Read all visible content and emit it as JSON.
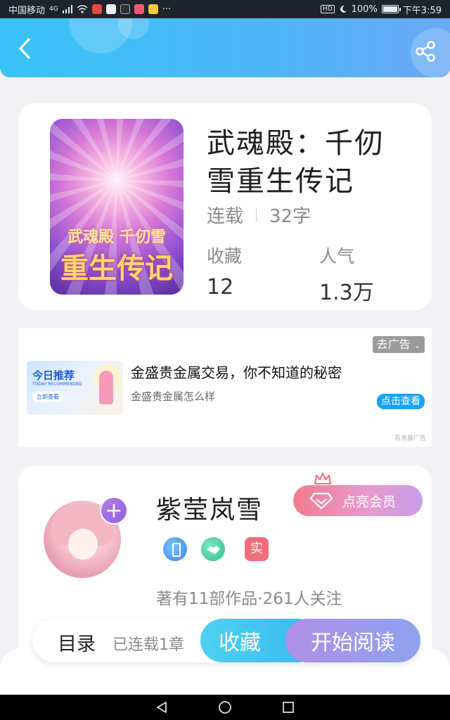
{
  "status_bar": {
    "carrier": "中国移动",
    "signal_label": "4G",
    "more": "···",
    "hd": "HD",
    "battery": "100%",
    "time": "下午3:59"
  },
  "header": {
    "back_icon": "chevron-left-icon",
    "share_icon": "share-icon",
    "colors": {
      "start": "#39c3f7",
      "end": "#6aa9f6"
    }
  },
  "book": {
    "title": "武魂殿：千仞雪重生传记",
    "cover_text_1": "武魂殿 千仞雪",
    "cover_text_2": "重生传记",
    "status": "连载",
    "word_count": "32字",
    "favorites_label": "收藏",
    "favorites_value": "12",
    "popularity_label": "人气",
    "popularity_value": "1.3万"
  },
  "ad": {
    "remove_label": "去广告",
    "image_title": "今日推荐",
    "image_subtitle": "TODAY RECOMMENDED",
    "image_cta": "立即查看",
    "title": "金盛贵金属交易，你不知道的秘密",
    "subtitle": "金盛贵金属怎么样",
    "cta": "点击查看",
    "source": "百青藤广告"
  },
  "author": {
    "name": "紫莹岚雪",
    "follow_label": "+",
    "vip_label": "点亮会员",
    "real_badge": "实",
    "stats": "著有11部作品·261人关注"
  },
  "actions": {
    "toc": "目录",
    "chapters": "已连载1章",
    "favorite": "收藏",
    "read": "开始阅读"
  },
  "colors": {
    "fav": "#39b9f2",
    "read": "#a493ea",
    "vip": "#f37c8f"
  }
}
